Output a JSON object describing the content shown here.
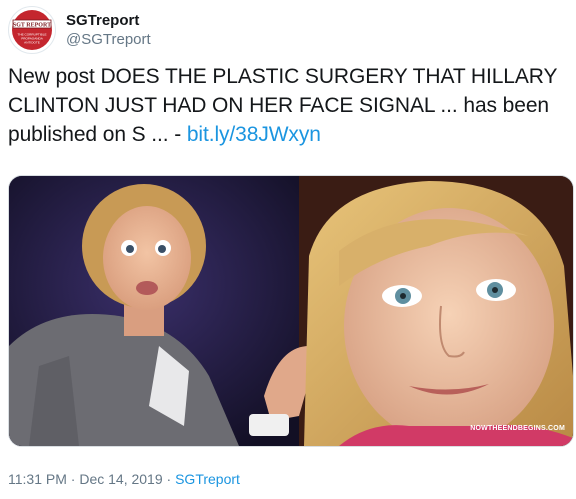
{
  "author": {
    "display_name": "SGTreport",
    "handle": "@SGTreport",
    "avatar_icon": "sgtreport-logo-icon",
    "avatar_logo_text": "SGT REPORT",
    "avatar_tagline": "THE CORRUPTIBLE PROPAGANDA ANTIDOTE"
  },
  "tweet": {
    "text_before_link": "New post DOES THE PLASTIC SURGERY THAT HILLARY CLINTON JUST HAD ON HER FACE SIGNAL ... has been published on S ... - ",
    "link_text": "bit.ly/38JWxyn"
  },
  "media": {
    "description_icon": "photo-collage-image",
    "watermark_text": "NOWTHEENDBEGINS.COM"
  },
  "meta": {
    "time": "11:31 PM",
    "separator1": " · ",
    "date": "Dec 14, 2019",
    "separator2": " · ",
    "source": "SGTreport"
  },
  "colors": {
    "link": "#1b95e0",
    "secondary_text": "#657786",
    "primary_text": "#14171a",
    "logo_red": "#c4262e"
  }
}
